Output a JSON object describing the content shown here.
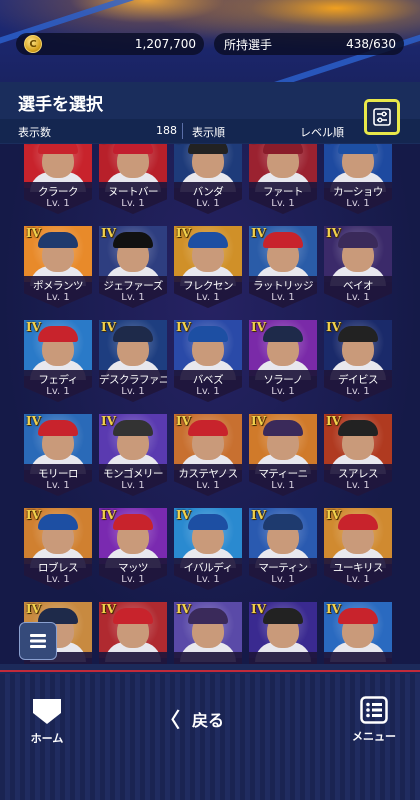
{
  "header": {
    "coin_value": "1,207,700",
    "coin_symbol": "C",
    "owned_label": "所持選手",
    "owned_value": "438/630"
  },
  "title": "選手を選択",
  "sub": {
    "count_label": "表示数",
    "count_value": "188",
    "order_label": "表示順",
    "order_value": "レベル順"
  },
  "rank_label": "IV",
  "players": [
    {
      "name": "クラーク",
      "level": "Lv. 1",
      "bg": "#c8232c",
      "cap": "#c8232c"
    },
    {
      "name": "ヌートバー",
      "level": "Lv. 1",
      "bg": "#b8202a",
      "cap": "#c21e2e"
    },
    {
      "name": "バンダ",
      "level": "Lv. 1",
      "bg": "#1e3b7a",
      "cap": "#222"
    },
    {
      "name": "ファート",
      "level": "Lv. 1",
      "bg": "#9b2230",
      "cap": "#8a1c2a"
    },
    {
      "name": "カーショウ",
      "level": "Lv. 1",
      "bg": "#1e4aa0",
      "cap": "#1d4fa3"
    },
    {
      "name": "ポメランツ",
      "level": "Lv. 1",
      "bg": "#e88a2a",
      "cap": "#1e3a6e"
    },
    {
      "name": "ジェファーズ",
      "level": "Lv. 1",
      "bg": "#2e3e80",
      "cap": "#111"
    },
    {
      "name": "フレクセン",
      "level": "Lv. 1",
      "bg": "#d09028",
      "cap": "#1d4fa3"
    },
    {
      "name": "ラットリッジ",
      "level": "Lv. 1",
      "bg": "#2a5ca8",
      "cap": "#c8232c"
    },
    {
      "name": "ベイオ",
      "level": "Lv. 1",
      "bg": "#3b2a6a",
      "cap": "#3a2a5a"
    },
    {
      "name": "フェディ",
      "level": "Lv. 1",
      "bg": "#2a7ac8",
      "cap": "#c8232c"
    },
    {
      "name": "デスクラファニー",
      "level": "Lv. 1",
      "bg": "#1e3e80",
      "cap": "#1e2a4a"
    },
    {
      "name": "バベズ",
      "level": "Lv. 1",
      "bg": "#2a4aa8",
      "cap": "#1d4fa3"
    },
    {
      "name": "ソラーノ",
      "level": "Lv. 1",
      "bg": "#7a2aa8",
      "cap": "#1e2a4a"
    },
    {
      "name": "デイビス",
      "level": "Lv. 1",
      "bg": "#1a2a6a",
      "cap": "#222"
    },
    {
      "name": "モリーロ",
      "level": "Lv. 1",
      "bg": "#2a6ab8",
      "cap": "#c8232c"
    },
    {
      "name": "モンゴメリー",
      "level": "Lv. 1",
      "bg": "#5a3ab0",
      "cap": "#333"
    },
    {
      "name": "カステヤノス",
      "level": "Lv. 1",
      "bg": "#c87030",
      "cap": "#c8232c"
    },
    {
      "name": "マティーニ",
      "level": "Lv. 1",
      "bg": "#d07a2a",
      "cap": "#3a2a5a"
    },
    {
      "name": "スアレス",
      "level": "Lv. 1",
      "bg": "#b03a20",
      "cap": "#222"
    },
    {
      "name": "ロブレス",
      "level": "Lv. 1",
      "bg": "#d08030",
      "cap": "#1d4fa3"
    },
    {
      "name": "マッツ",
      "level": "Lv. 1",
      "bg": "#7a2ab0",
      "cap": "#c8232c"
    },
    {
      "name": "イバルディ",
      "level": "Lv. 1",
      "bg": "#2a8ad0",
      "cap": "#1d4fa3"
    },
    {
      "name": "マーティン",
      "level": "Lv. 1",
      "bg": "#2a5ab0",
      "cap": "#1e3a6e"
    },
    {
      "name": "ユーキリス",
      "level": "Lv. 1",
      "bg": "#d08a30",
      "cap": "#c8232c"
    },
    {
      "name": "",
      "level": "",
      "bg": "#c88a40",
      "cap": "#1e2a4a"
    },
    {
      "name": "",
      "level": "",
      "bg": "#b02a30",
      "cap": "#c8232c"
    },
    {
      "name": "",
      "level": "",
      "bg": "#5a4aa8",
      "cap": "#3a2a5a"
    },
    {
      "name": "",
      "level": "",
      "bg": "#3a2a90",
      "cap": "#222"
    },
    {
      "name": "",
      "level": "",
      "bg": "#2a6ac0",
      "cap": "#c8232c"
    }
  ],
  "nav": {
    "home_label": "ホーム",
    "back_label": "戻る",
    "menu_label": "メニュー"
  },
  "colors": {
    "accent_yellow": "#e9e84a",
    "rank_gold": "#f2d14b",
    "bottom_red": "#c22a3a"
  }
}
